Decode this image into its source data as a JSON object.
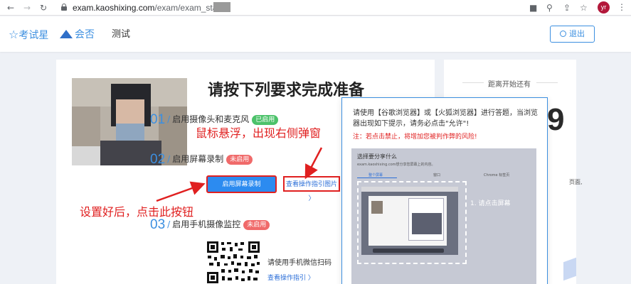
{
  "browser": {
    "url_domain": "exam.kaoshixing.com",
    "url_path": "/exam/exam_start/",
    "avatar_text": "yr",
    "icons": [
      "back-icon",
      "forward-icon",
      "reload-icon",
      "lock-icon",
      "camera-icon",
      "search-icon",
      "share-icon",
      "bookmark-star-icon",
      "more-icon"
    ]
  },
  "header": {
    "logo_1": "考试星",
    "logo_2": "会否",
    "nav_item": "测试",
    "exit_label": "退出"
  },
  "main": {
    "heading": "请按下列要求完成准备",
    "steps": [
      {
        "num": "01",
        "label": "启用摄像头和麦克风",
        "badge": "已启用",
        "badge_state": "enabled"
      },
      {
        "num": "02",
        "label": "启用屏幕录制",
        "badge": "未启用",
        "badge_state": "disabled"
      },
      {
        "num": "03",
        "label": "启用手机摄像监控",
        "badge": "未启用",
        "badge_state": "disabled"
      }
    ],
    "start_recording_button": "启用屏幕录制",
    "guide_link": "查看操作指引图片 〉",
    "qr_text": "请使用手机微信扫码",
    "qr_guide_link": "查看操作指引 〉"
  },
  "annotations": {
    "hover_note": "鼠标悬浮，出现右侧弹窗",
    "click_note": "设置好后，点击此按钮",
    "color": "#e02020"
  },
  "right_panel": {
    "countdown_label": "距离开始还有",
    "big_digit": "9",
    "side_text": "页面,"
  },
  "popup": {
    "instruction": "请使用【谷歌浏览器】或【火狐浏览器】进行答题，当浏览器出现如下提示，请务必点击\"允许\"!",
    "warning": "注：若点击禁止，将增加您被判作弊的风险!",
    "screenshot": {
      "title": "选择要分享什么",
      "subtitle": "exam.kaoshixing.com想分享您屏幕上的内容。",
      "tabs": [
        "整个屏幕",
        "窗口",
        "Chrome 标签页"
      ],
      "hint": "1. 请点击屏幕"
    }
  },
  "colors": {
    "brand_blue": "#3c8fe0",
    "primary_button": "#2c8bf0",
    "enabled_badge": "#4cc26a",
    "disabled_badge": "#f06a6a",
    "annotation_red": "#e02020"
  }
}
